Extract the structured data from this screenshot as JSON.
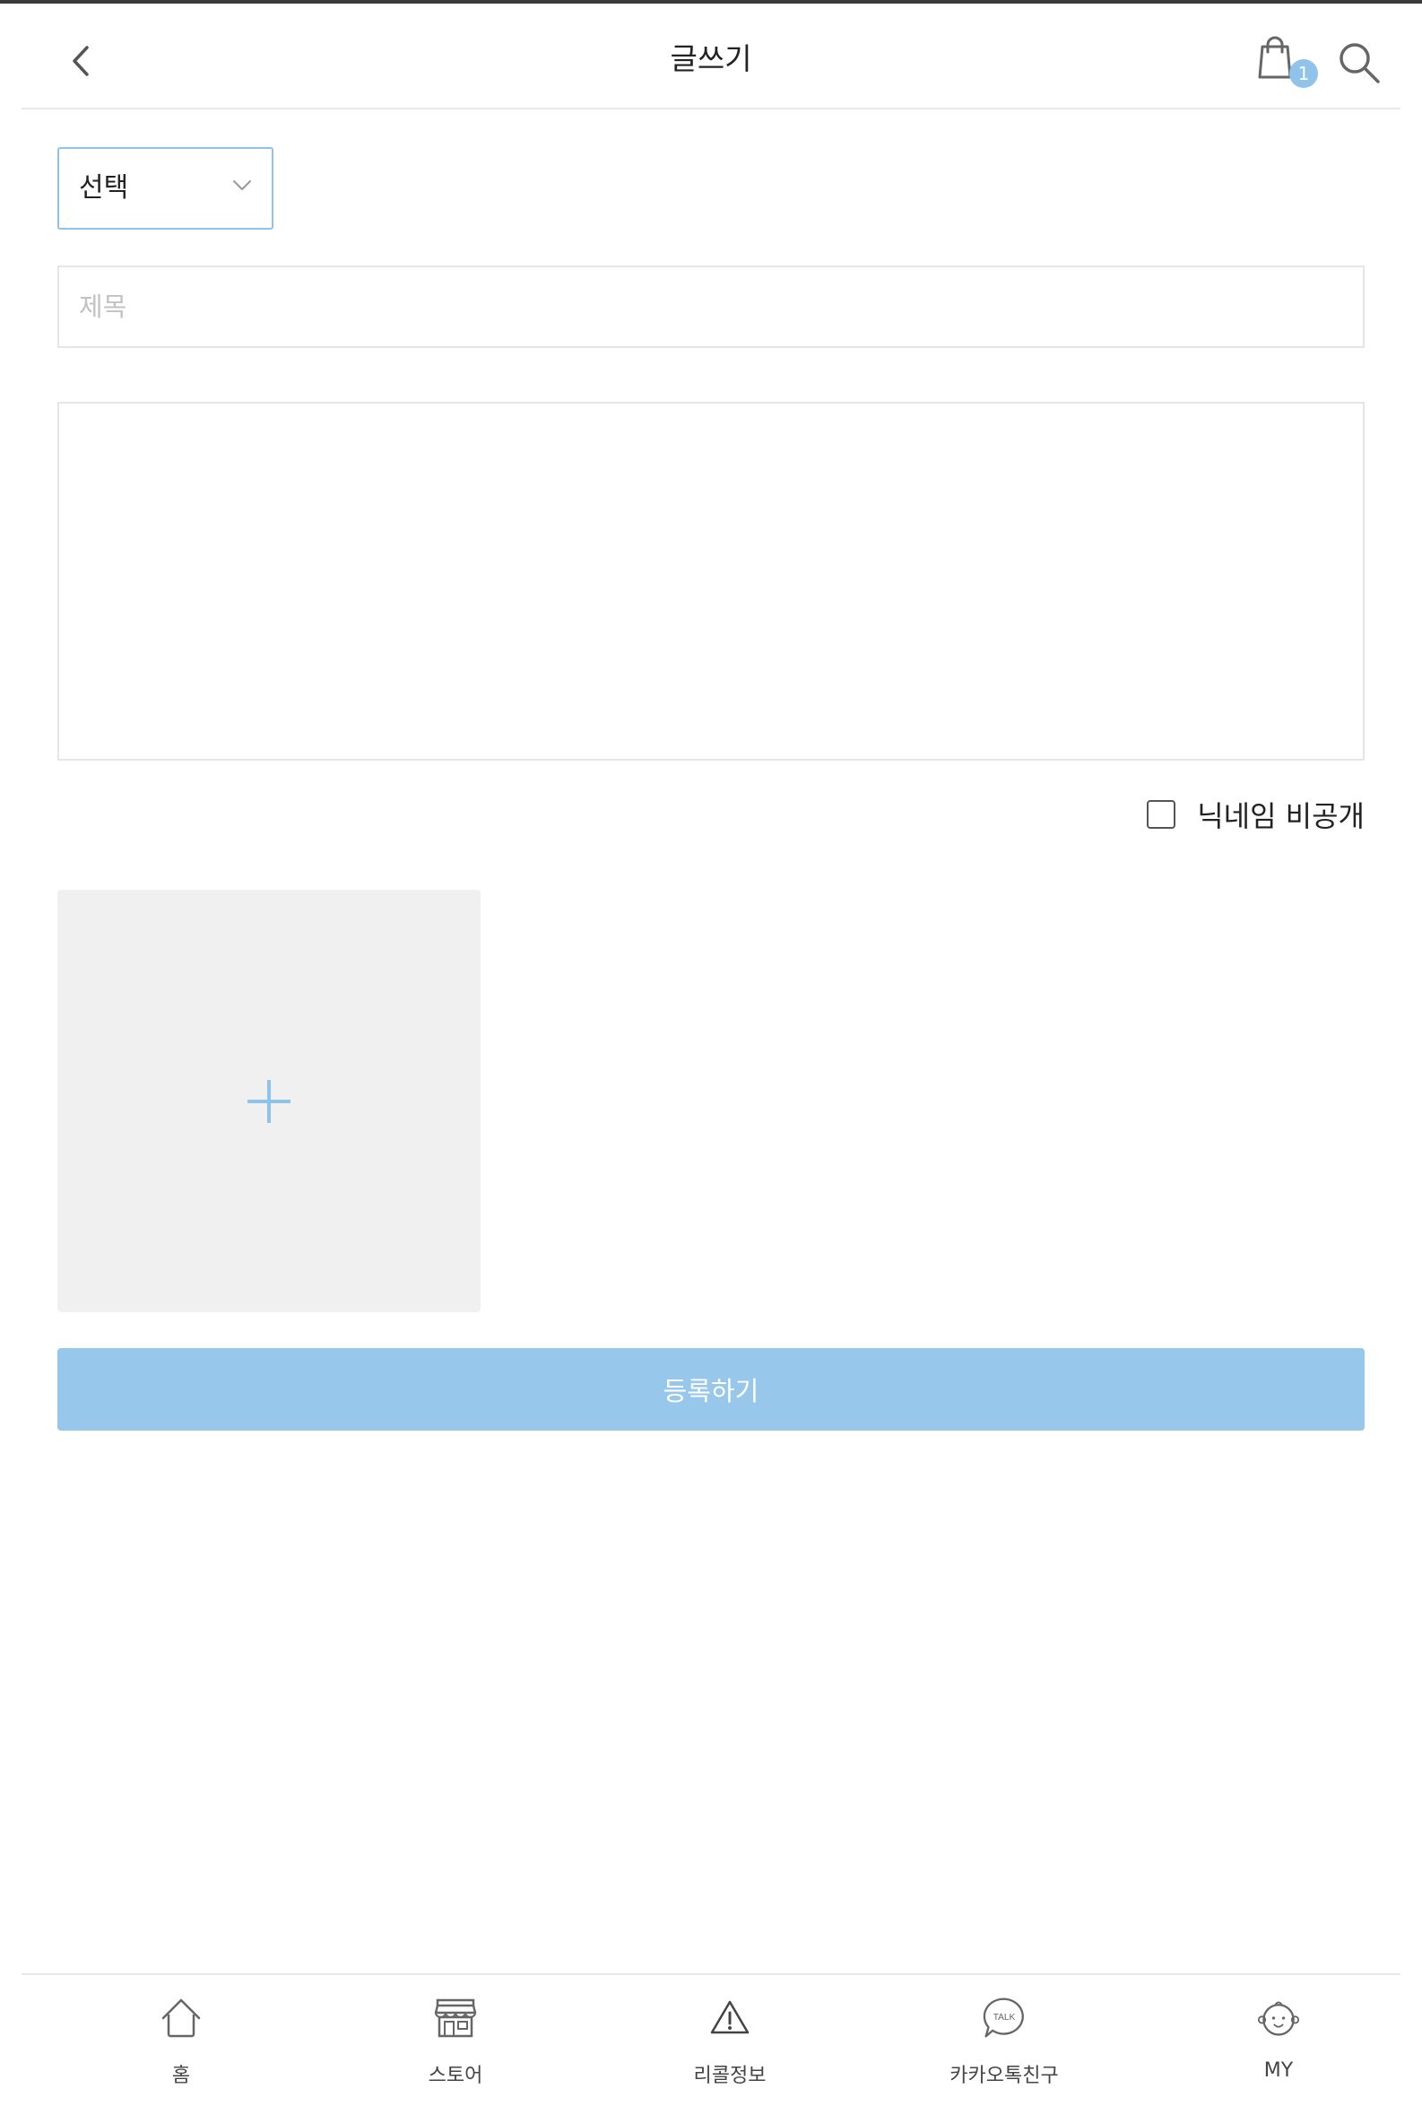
{
  "header": {
    "title": "글쓰기",
    "cart_count": "1",
    "back_icon": "chevron-left-icon",
    "cart_icon": "shopping-bag-icon",
    "search_icon": "search-icon"
  },
  "form": {
    "category": {
      "selected": "선택",
      "icon": "chevron-down-icon"
    },
    "title": {
      "placeholder": "제목",
      "value": ""
    },
    "content": {
      "placeholder": "",
      "value": ""
    },
    "hide_nickname": {
      "label": "닉네임 비공개",
      "checked": false
    },
    "image_upload": {
      "icon": "plus-icon"
    },
    "submit_label": "등록하기"
  },
  "bottom_nav": {
    "items": [
      {
        "label": "홈",
        "icon": "home-icon"
      },
      {
        "label": "스토어",
        "icon": "store-icon"
      },
      {
        "label": "리콜정보",
        "icon": "warning-icon"
      },
      {
        "label": "카카오톡친구",
        "icon": "kakaotalk-icon",
        "icon_text": "TALK"
      },
      {
        "label": "MY",
        "icon": "baby-face-icon"
      }
    ]
  },
  "colors": {
    "accent": "#8fc3ea",
    "submit_bg": "#97c7ea",
    "upload_bg": "#f0f0f0",
    "border": "#e6e6e6"
  }
}
